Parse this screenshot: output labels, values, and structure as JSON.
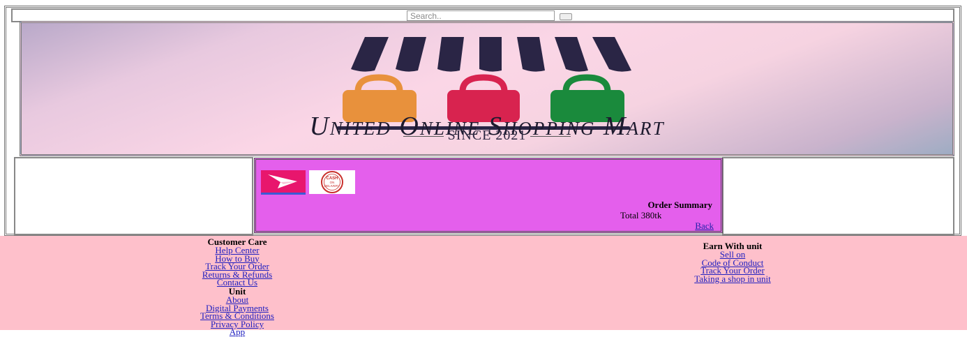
{
  "search": {
    "placeholder": "Search.."
  },
  "banner": {
    "title": "United Online Shopping Mart",
    "subtitle": "SINCE 2021"
  },
  "payment": {
    "cod_text": [
      "CASH",
      "ON",
      "DELIVERY"
    ]
  },
  "order": {
    "title": "Order Summary",
    "total": "Total 380tk",
    "back_label": "Back"
  },
  "footer": {
    "customer_care": {
      "heading": "Customer Care",
      "links": [
        "Help Center",
        "How to Buy",
        "Track Your Order",
        "Returns & Refunds",
        "Contact Us"
      ]
    },
    "unit": {
      "heading": "Unit",
      "links": [
        "About",
        "Digital Payments",
        "Terms & Conditions",
        "Privacy Policy",
        "App"
      ]
    },
    "earn": {
      "heading": "Earn With unit",
      "links": [
        "Sell on",
        "Code of Conduct",
        "Track Your Order",
        "Taking a shop in unit"
      ]
    }
  },
  "colors": {
    "order_panel": "#e45fec",
    "footer_bg": "#fec0cb",
    "link": "#2020c0",
    "bag_orange": "#e8913c",
    "bag_red": "#d8234f",
    "bag_green": "#1a8a3c",
    "awning": "#2a2545"
  }
}
